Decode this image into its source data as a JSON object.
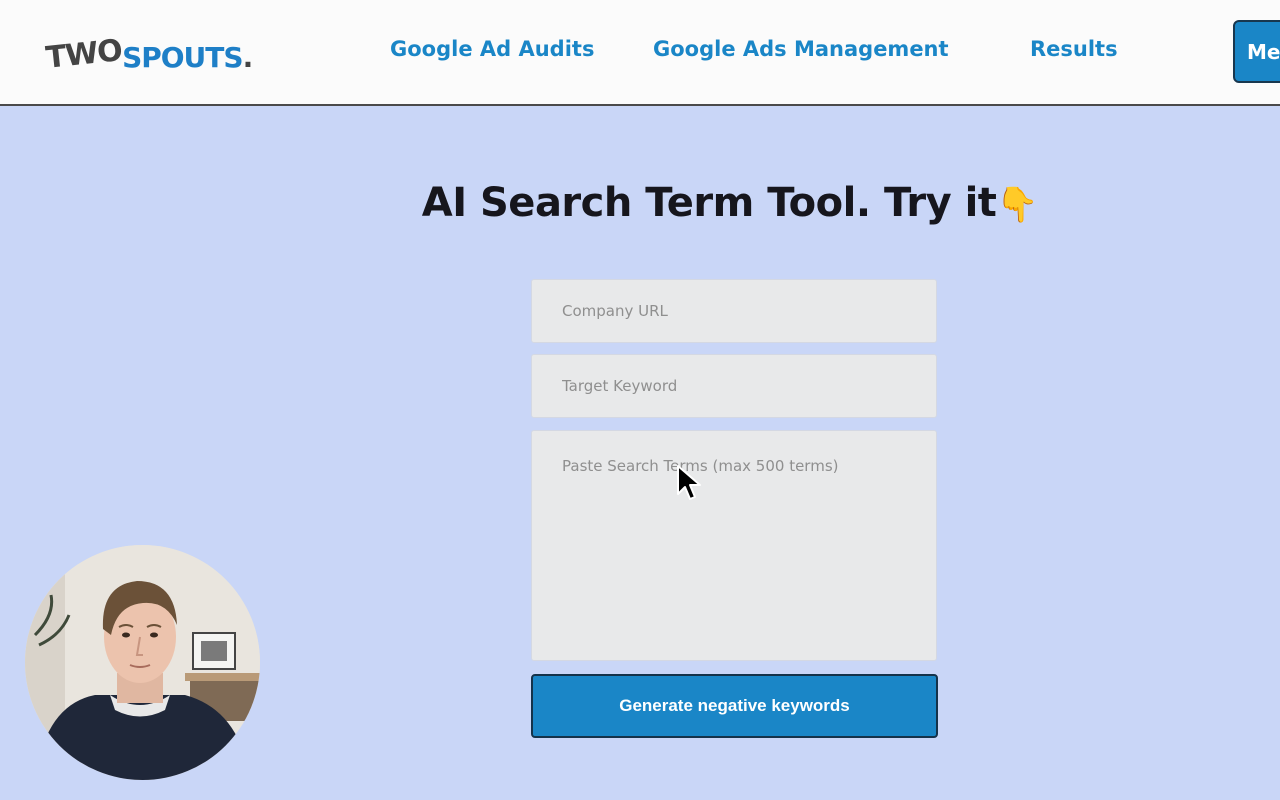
{
  "header": {
    "logo_two": "TWO",
    "logo_spouts": "SPOUTS",
    "logo_dot": ".",
    "nav": {
      "audits": "Google Ad Audits",
      "management": "Google Ads Management",
      "results": "Results"
    },
    "cta_label": "Me"
  },
  "hero": {
    "title": "AI Search Term Tool. Try it",
    "title_emoji": "👇"
  },
  "form": {
    "company_url_placeholder": "Company URL",
    "target_keyword_placeholder": "Target Keyword",
    "search_terms_placeholder": "Paste Search Terms (max 500 terms)",
    "submit_label": "Generate negative keywords"
  },
  "colors": {
    "brand_blue": "#1a86c7",
    "page_background": "#c9d6f7",
    "header_background": "#fbfbfb",
    "field_background": "#e8e9ea"
  }
}
